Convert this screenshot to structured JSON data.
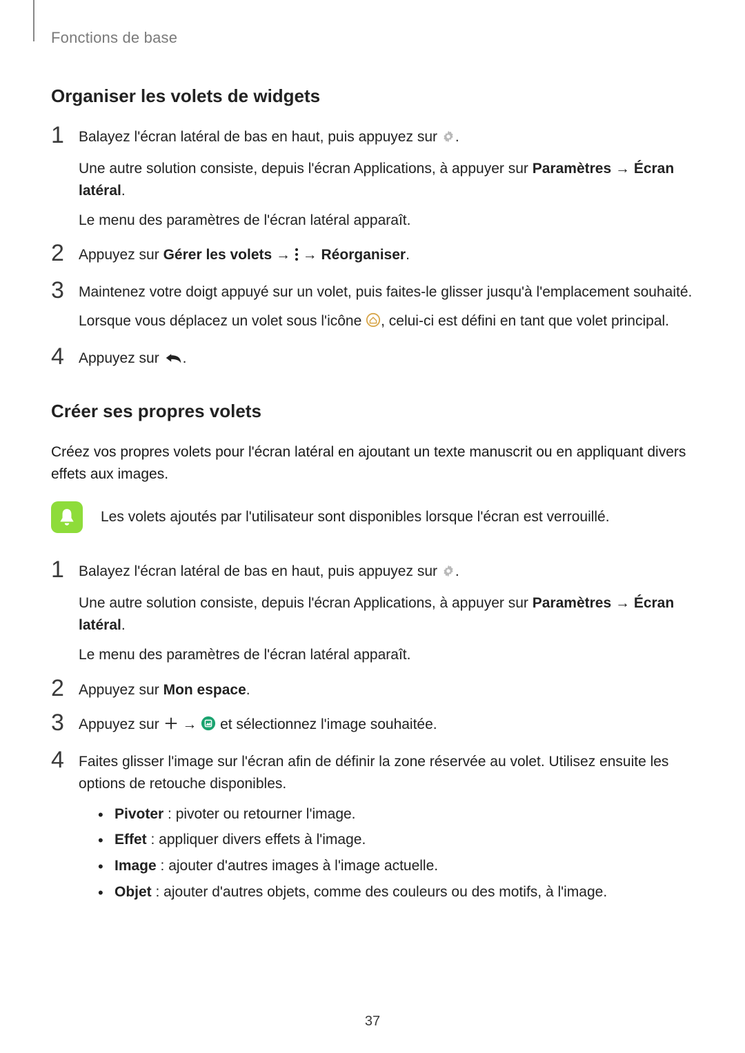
{
  "breadcrumb": "Fonctions de base",
  "section1": {
    "title": "Organiser les volets de widgets",
    "step1": {
      "num": "1",
      "line1a": "Balayez l'écran latéral de bas en haut, puis appuyez sur ",
      "line1b": ".",
      "line2a": "Une autre solution consiste, depuis l'écran Applications, à appuyer sur ",
      "line2_bold1": "Paramètres",
      "line2_arrow": " → ",
      "line2_bold2": "Écran latéral",
      "line2b": ".",
      "line3": "Le menu des paramètres de l'écran latéral apparaît."
    },
    "step2": {
      "num": "2",
      "pre": "Appuyez sur ",
      "bold1": "Gérer les volets",
      "arrow1": " → ",
      "arrow2": " → ",
      "bold2": "Réorganiser",
      "end": "."
    },
    "step3": {
      "num": "3",
      "line1": "Maintenez votre doigt appuyé sur un volet, puis faites-le glisser jusqu'à l'emplacement souhaité.",
      "line2a": "Lorsque vous déplacez un volet sous l'icône ",
      "line2b": ", celui-ci est défini en tant que volet principal."
    },
    "step4": {
      "num": "4",
      "pre": "Appuyez sur ",
      "end": "."
    }
  },
  "section2": {
    "title": "Créer ses propres volets",
    "intro": "Créez vos propres volets pour l'écran latéral en ajoutant un texte manuscrit ou en appliquant divers effets aux images.",
    "note": "Les volets ajoutés par l'utilisateur sont disponibles lorsque l'écran est verrouillé.",
    "step1": {
      "num": "1",
      "line1a": "Balayez l'écran latéral de bas en haut, puis appuyez sur ",
      "line1b": ".",
      "line2a": "Une autre solution consiste, depuis l'écran Applications, à appuyer sur ",
      "line2_bold1": "Paramètres",
      "line2_arrow": " → ",
      "line2_bold2": "Écran latéral",
      "line2b": ".",
      "line3": "Le menu des paramètres de l'écran latéral apparaît."
    },
    "step2": {
      "num": "2",
      "pre": "Appuyez sur ",
      "bold1": "Mon espace",
      "end": "."
    },
    "step3": {
      "num": "3",
      "pre": "Appuyez sur ",
      "arrow1": " → ",
      "post": " et sélectionnez l'image souhaitée."
    },
    "step4": {
      "num": "4",
      "line": "Faites glisser l'image sur l'écran afin de définir la zone réservée au volet. Utilisez ensuite les options de retouche disponibles.",
      "bullets": [
        {
          "bold": "Pivoter",
          "rest": " : pivoter ou retourner l'image."
        },
        {
          "bold": "Effet",
          "rest": " : appliquer divers effets à l'image."
        },
        {
          "bold": "Image",
          "rest": " : ajouter d'autres images à l'image actuelle."
        },
        {
          "bold": "Objet",
          "rest": " : ajouter d'autres objets, comme des couleurs ou des motifs, à l'image."
        }
      ]
    }
  },
  "page_number": "37"
}
